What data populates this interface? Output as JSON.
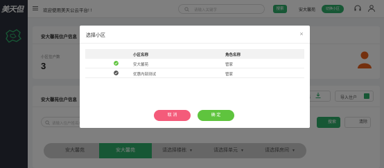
{
  "brand": {
    "logo_text": "美天但"
  },
  "header": {
    "welcome": "欢迎使用美天公云平台! !",
    "search_placeholder": "请输入关键字",
    "search_button": "搜索",
    "current_community": "安大馨苑",
    "switch_button": "切换小区",
    "icons": [
      "headset-icon",
      "user-icon"
    ]
  },
  "summary": {
    "title": "安大馨苑住户信息",
    "stat_label": "小区住户数",
    "stat_value": "3"
  },
  "list": {
    "title": "安大馨苑住户信息",
    "export_label": "导出",
    "import_label": "导入住户",
    "search_placeholder": "请输入住户姓名或",
    "query_button": "搜索",
    "clear_button": "清除"
  },
  "filters": [
    {
      "label": "安大馨苑",
      "active": false
    },
    {
      "label": "安大馨苑",
      "active": true
    },
    {
      "label": "请选择楼栋",
      "active": false
    },
    {
      "label": "请选择单元",
      "active": false
    },
    {
      "label": "请选择房间",
      "active": false
    }
  ],
  "modal": {
    "title": "选择小区",
    "columns": [
      "小区名称",
      "角色名称"
    ],
    "rows": [
      {
        "name": "安大馨苑",
        "role": "管家",
        "selected": true
      },
      {
        "name": "优惠内部测试",
        "role": "管家",
        "selected": false
      }
    ],
    "cancel_button": "取 消",
    "confirm_button": "确 定"
  },
  "colors": {
    "primary_green": "#2eaf6a",
    "cancel_pink": "#f45b7a",
    "confirm_green": "#5fc43e",
    "sidebar": "#2b2f3a"
  }
}
